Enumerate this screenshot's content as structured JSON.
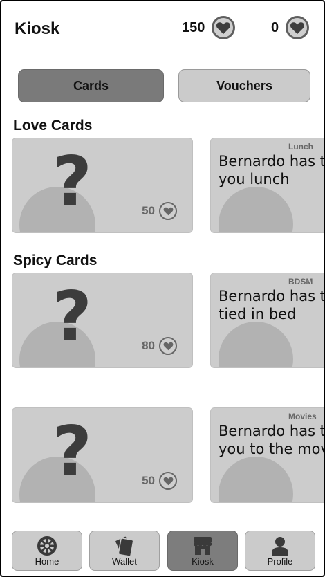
{
  "header": {
    "title": "Kiosk",
    "balances": [
      {
        "value": "150",
        "icon": "heart-coin-icon"
      },
      {
        "value": "0",
        "icon": "heart-coin-icon"
      }
    ]
  },
  "tabs": [
    {
      "label": "Cards",
      "active": true
    },
    {
      "label": "Vouchers",
      "active": false
    }
  ],
  "sections": [
    {
      "title": "Love Cards",
      "mystery_card": {
        "symbol": "?",
        "price": "50"
      },
      "preview_card": {
        "category": "Lunch",
        "text": "Bernardo has t\nyou lunch"
      }
    },
    {
      "title": "Spicy Cards",
      "mystery_card": {
        "symbol": "?",
        "price": "80"
      },
      "preview_card": {
        "category": "BDSM",
        "text": "Bernardo has t\ntied in bed"
      }
    },
    {
      "title": "",
      "mystery_card": {
        "symbol": "?",
        "price": "50"
      },
      "preview_card": {
        "category": "Movies",
        "text": "Bernardo has t\nyou to the mov"
      }
    }
  ],
  "nav": [
    {
      "label": "Home",
      "icon": "home-wheel-icon",
      "active": false
    },
    {
      "label": "Wallet",
      "icon": "wallet-cards-icon",
      "active": false
    },
    {
      "label": "Kiosk",
      "icon": "store-icon",
      "active": true
    },
    {
      "label": "Profile",
      "icon": "user-icon",
      "active": false
    }
  ],
  "colors": {
    "active_tab": "#7a7a7a",
    "inactive_tab": "#cbcbcb",
    "card_bg": "#cccccc",
    "border": "#000000"
  }
}
